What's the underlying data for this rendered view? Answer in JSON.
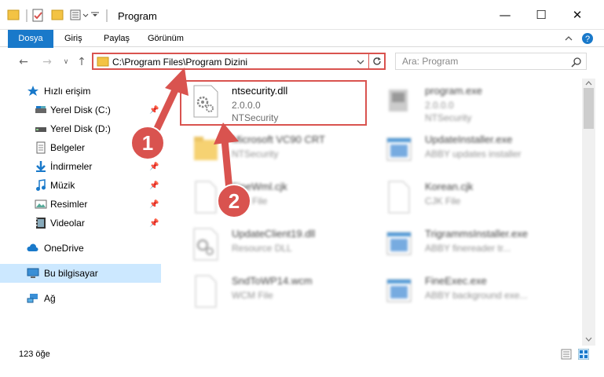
{
  "window": {
    "title": "Program",
    "minimize_icon": "—",
    "maximize_icon": "☐",
    "close_icon": "✕"
  },
  "ribbon": {
    "tabs": [
      "Dosya",
      "Giriş",
      "Paylaş",
      "Görünüm"
    ]
  },
  "address_bar": {
    "path": "C:\\Program Files\\Program Dizini"
  },
  "search": {
    "placeholder": "Ara: Program"
  },
  "sidebar": {
    "items": [
      {
        "label": "Hızlı erişim",
        "icon": "star-icon",
        "pinned": false
      },
      {
        "label": "Yerel Disk (C:)",
        "icon": "drive-icon",
        "pinned": true
      },
      {
        "label": "Yerel Disk (D:)",
        "icon": "drive-icon",
        "pinned": false
      },
      {
        "label": "Belgeler",
        "icon": "documents-icon",
        "pinned": true
      },
      {
        "label": "İndirmeler",
        "icon": "download-icon",
        "pinned": true
      },
      {
        "label": "Müzik",
        "icon": "music-icon",
        "pinned": true
      },
      {
        "label": "Resimler",
        "icon": "pictures-icon",
        "pinned": true
      },
      {
        "label": "Videolar",
        "icon": "videos-icon",
        "pinned": true
      },
      {
        "label": "OneDrive",
        "icon": "cloud-icon",
        "pinned": false
      },
      {
        "label": "Bu bilgisayar",
        "icon": "computer-icon",
        "pinned": false,
        "selected": true
      },
      {
        "label": "Ağ",
        "icon": "network-icon",
        "pinned": false
      }
    ]
  },
  "files": [
    {
      "name": "ntsecurity.dll",
      "line2": "2.0.0.0",
      "line3": "NTSecurity",
      "icon": "dll-gear-icon",
      "highlighted": true
    },
    {
      "name": "program.exe",
      "line2": "2.0.0.0",
      "line3": "NTSecurity",
      "icon": "exe-icon"
    },
    {
      "name": "Microsoft VC90 CRT",
      "line2": "NTSecurity",
      "line3": "",
      "icon": "folder-icon"
    },
    {
      "name": "UpdateInstaller.exe",
      "line2": "ABBY updates installer",
      "line3": "",
      "icon": "window-exe-icon"
    },
    {
      "name": "FineWml.cjk",
      "line2": "CJK File",
      "line3": "",
      "icon": "file-icon"
    },
    {
      "name": "Korean.cjk",
      "line2": "CJK File",
      "line3": "",
      "icon": "file-icon"
    },
    {
      "name": "UpdateClient19.dll",
      "line2": "Resource DLL",
      "line3": "",
      "icon": "dll-gear-icon"
    },
    {
      "name": "TrigrammsInstaller.exe",
      "line2": "ABBY finereader tr...",
      "line3": "",
      "icon": "window-exe-icon"
    },
    {
      "name": "SndToWP14.wcm",
      "line2": "WCM File",
      "line3": "",
      "icon": "file-icon"
    },
    {
      "name": "FineExec.exe",
      "line2": "ABBY background exe...",
      "line3": "",
      "icon": "window-exe-icon"
    }
  ],
  "annotations": {
    "step1": "1",
    "step2": "2",
    "color": "#d9534f"
  },
  "status": {
    "count": "123 öğe"
  }
}
